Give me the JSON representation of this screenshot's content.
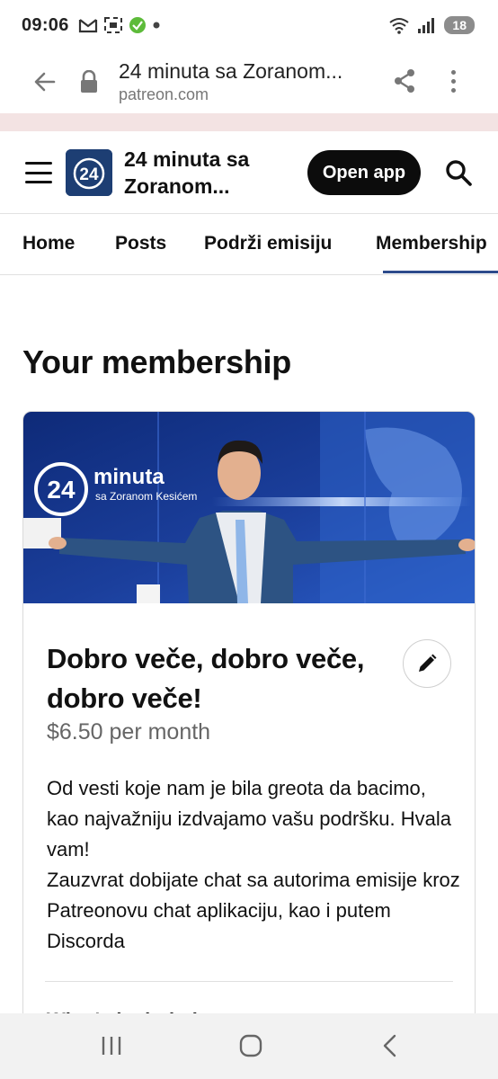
{
  "status_bar": {
    "time": "09:06",
    "battery": "18",
    "left_icons": [
      "gmail-icon",
      "screen-record-icon",
      "app-notification-icon",
      "dot-icon"
    ],
    "right_icons": [
      "wifi-icon",
      "signal-icon",
      "battery-icon"
    ]
  },
  "browser": {
    "page_title": "24 minuta sa Zoranom...",
    "domain": "patreon.com"
  },
  "header": {
    "site_title": "24 minuta sa Zoranom...",
    "open_app_label": "Open app",
    "logo_text": "24"
  },
  "tabs": [
    {
      "label": "Home",
      "active": false
    },
    {
      "label": "Posts",
      "active": false
    },
    {
      "label": "Podrži emisiju",
      "active": false
    },
    {
      "label": "Membership",
      "active": true
    }
  ],
  "page": {
    "heading": "Your membership"
  },
  "tier": {
    "banner_logo_main": "minuta",
    "banner_logo_number": "24",
    "banner_logo_sub": "sa Zoranom Kesićem",
    "title": "Dobro veče, dobro veče, dobro veče!",
    "price": "$6.50 per month",
    "description_lines": [
      "Od vesti koje nam je bila greota da bacimo, kao najvažniju izdvajamo vašu podršku. Hvala vam!",
      "Zauzvrat dobijate chat sa autorima emisije kroz Patreonovu chat aplikaciju, kao i putem Discorda"
    ],
    "included_heading": "What's included"
  },
  "colors": {
    "accent_underline": "#2d4b8c",
    "button_dark": "#0c0c0c",
    "banner_blue": "#1b3f9c"
  }
}
